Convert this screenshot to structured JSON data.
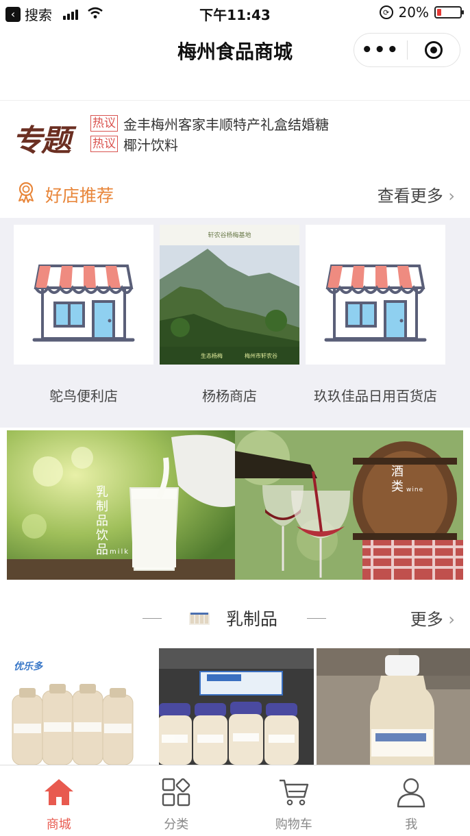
{
  "status_bar": {
    "back_app": "搜索",
    "time": "下午11:43",
    "battery": "20%",
    "battery_level": 0.2
  },
  "nav": {
    "title": "梅州食品商城",
    "more_symbol": "•••"
  },
  "topic": {
    "logo_text": "专题",
    "items": [
      {
        "tag": "热议",
        "text": "金丰梅州客家丰顺特产礼盒结婚糖"
      },
      {
        "tag": "热议",
        "text": "椰汁饮料"
      }
    ]
  },
  "good_shops": {
    "title": "好店推荐",
    "more": "查看更多",
    "shops": [
      {
        "name": "鸵鸟便利店"
      },
      {
        "name": "杨杨商店",
        "image_caption": "轩农谷杨梅基地",
        "image_tags": [
          "生态杨梅",
          "梅州市轩农谷"
        ]
      },
      {
        "name": "玖玖佳品日用百货店"
      }
    ]
  },
  "banners": [
    {
      "title": "乳制品饮品",
      "subtitle": "milk"
    },
    {
      "title": "酒类",
      "subtitle": "wine"
    }
  ],
  "dairy_section": {
    "title": "乳制品",
    "more": "更多",
    "brand_label": "优乐多"
  },
  "tabbar": [
    {
      "label": "商城",
      "icon": "home-icon",
      "active": true
    },
    {
      "label": "分类",
      "icon": "category-icon",
      "active": false
    },
    {
      "label": "购物车",
      "icon": "cart-icon",
      "active": false
    },
    {
      "label": "我",
      "icon": "user-icon",
      "active": false
    }
  ],
  "colors": {
    "accent": "#e85a4f",
    "good_shop_title": "#e8863a",
    "hot_tag": "#d9534f"
  }
}
